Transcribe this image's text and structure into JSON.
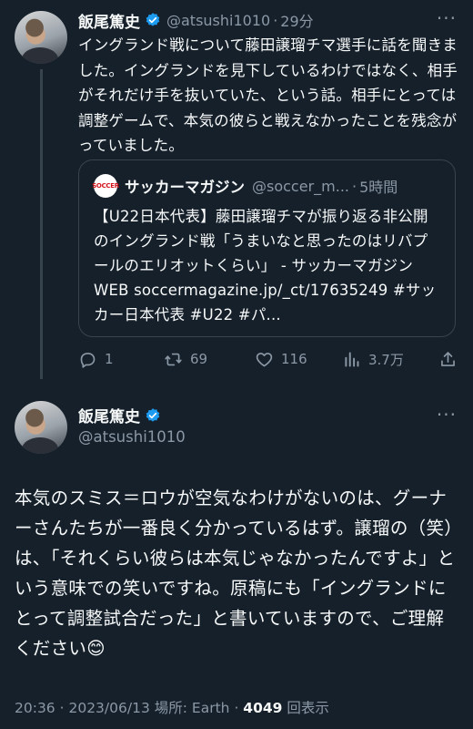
{
  "tweet1": {
    "author_name": "飯尾篤史",
    "handle": "@atsushi1010",
    "time": "29分",
    "more": "···",
    "body": "イングランド戦について藤田譲瑠チマ選手に話を聞きました。イングランドを見下しているわけではなく、相手がそれだけ手を抜いていた、という話。相手にとっては調整ゲームで、本気の彼らと戦えなかったことを残念がっていました。",
    "quote": {
      "logo_text": "SOCCER",
      "author_name": "サッカーマガジン",
      "handle": "@soccer_m...",
      "time": "5時間",
      "body": "【U22日本代表】藤田譲瑠チマが振り返る非公開のイングランド戦「うまいなと思ったのはリバプールのエリオットくらい」 - サッカーマガジン WEB soccermagazine.jp/_ct/17635249 #サッカー日本代表 #U22 #パ..."
    },
    "actions": {
      "reply_count": "1",
      "retweet_count": "69",
      "like_count": "116",
      "view_count": "3.7万"
    }
  },
  "tweet2": {
    "author_name": "飯尾篤史",
    "handle": "@atsushi1010",
    "more": "···",
    "body": "本気のスミス＝ロウが空気なわけがないのは、グーナーさんたちが一番良く分かっているはず。譲瑠の（笑）は、「それくらい彼らは本気じゃなかったんですよ」という意味での笑いですね。原稿にも「イングランドにとって調整試合だった」と書いていますので、ご理解ください😊",
    "time": "20:36",
    "date": "2023/06/13",
    "location_label": "場所:",
    "location": "Earth",
    "views": "4049",
    "views_label": "回表示"
  },
  "colors": {
    "background": "#15202b",
    "text": "#f7f9f9",
    "muted": "#8b98a5",
    "verified": "#1d9bf0",
    "border": "#38444d"
  }
}
